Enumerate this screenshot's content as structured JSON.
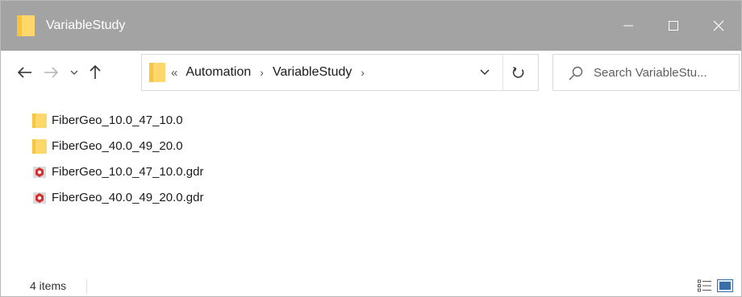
{
  "window": {
    "title": "VariableStudy"
  },
  "address": {
    "overflow": "«",
    "segments": [
      "Automation",
      "VariableStudy"
    ],
    "trailing_chevron": "›"
  },
  "search": {
    "placeholder": "Search VariableStu..."
  },
  "files": [
    {
      "name": "FiberGeo_10.0_47_10.0",
      "type": "folder"
    },
    {
      "name": "FiberGeo_40.0_49_20.0",
      "type": "folder"
    },
    {
      "name": "FiberGeo_10.0_47_10.0.gdr",
      "type": "gdr"
    },
    {
      "name": "FiberGeo_40.0_49_20.0.gdr",
      "type": "gdr"
    }
  ],
  "status": {
    "item_count": "4 items"
  },
  "colors": {
    "titlebar": "#a3a3a3",
    "folder": "#ffd76a",
    "gdr_red": "#d32f2f"
  }
}
